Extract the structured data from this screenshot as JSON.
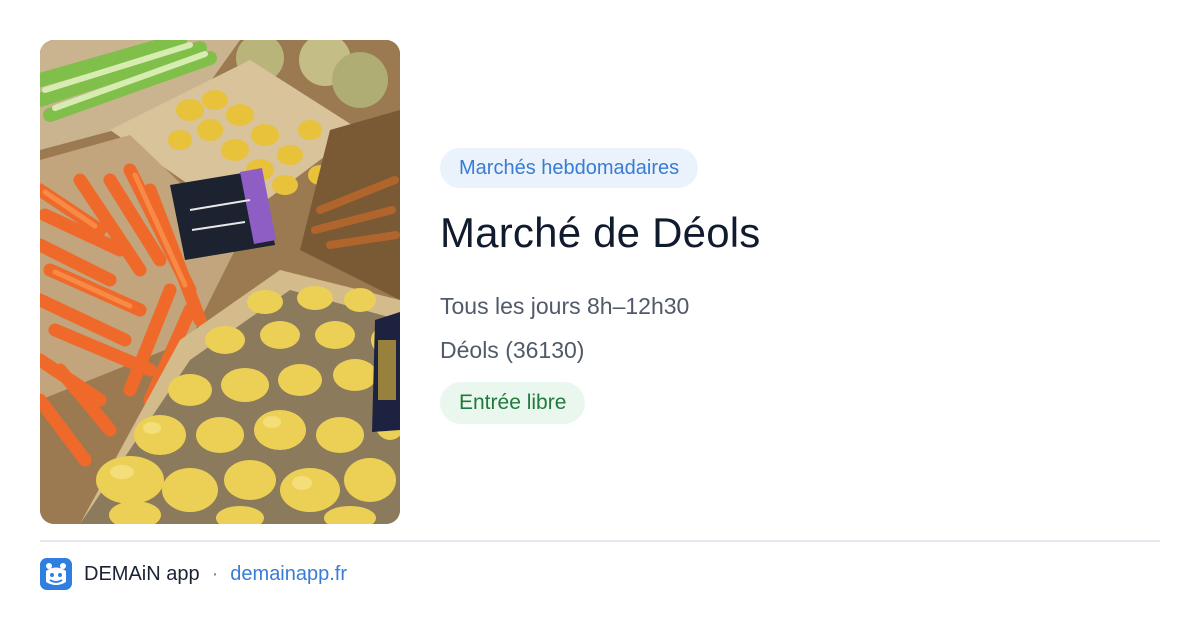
{
  "card": {
    "photo_icon": "market-produce-photo",
    "category": "Marchés hebdomadaires",
    "title": "Marché de Déols",
    "schedule": "Tous les jours 8h–12h30",
    "location": "Déols (36130)",
    "entry": "Entrée libre"
  },
  "footer": {
    "app_icon": "demain-app-icon",
    "app_name": "DEMAiN app",
    "separator": "·",
    "domain": "demainapp.fr"
  },
  "colors": {
    "category_pill_bg": "#eaf2fb",
    "category_pill_text": "#3a7bd5",
    "entry_pill_bg": "#eaf7ee",
    "entry_pill_text": "#217a3d",
    "link": "#3a7bd5",
    "brand": "#2f7fe0"
  }
}
